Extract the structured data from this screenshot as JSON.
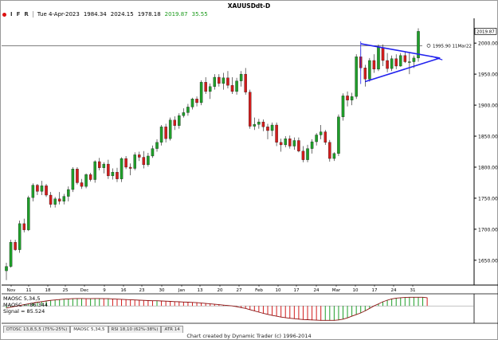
{
  "window": {
    "title": "XAUUSDdt-D",
    "toolbar": [
      "I",
      "F",
      "R"
    ]
  },
  "info": {
    "date": "Tue 4-Apr-2023",
    "open": "1984.34",
    "high": "2024.15",
    "low": "1978.18",
    "close": "2019.87",
    "change": "35.55"
  },
  "price_panel": {
    "last_price_label": "2019.87",
    "annotation": "1995.90 11Mar22",
    "colors": {
      "up": "#1f9e2a",
      "down": "#d21c1c",
      "triangle": "#2222ee",
      "background": "#ffffff"
    }
  },
  "chart_data": [
    {
      "type": "candlestick",
      "title": "XAUUSDdt-D",
      "ylim": [
        1610,
        2040
      ],
      "yticks": [
        1650,
        1700,
        1750,
        1800,
        1850,
        1900,
        1950,
        2000
      ],
      "xlabels": [
        "Nov",
        "11",
        "18",
        "25",
        "Dec",
        "9",
        "16",
        "23",
        "30",
        "Jan",
        "13",
        "20",
        "27",
        "Feb",
        "10",
        "17",
        "24",
        "Mar",
        "10",
        "17",
        "24",
        "31"
      ],
      "grid": false,
      "candles": [
        [
          1633,
          1646,
          1618,
          1640
        ],
        [
          1640,
          1683,
          1638,
          1679
        ],
        [
          1679,
          1683,
          1665,
          1667
        ],
        [
          1667,
          1714,
          1662,
          1709
        ],
        [
          1709,
          1717,
          1695,
          1699
        ],
        [
          1699,
          1754,
          1697,
          1751
        ],
        [
          1751,
          1774,
          1745,
          1771
        ],
        [
          1771,
          1773,
          1755,
          1761
        ],
        [
          1761,
          1778,
          1755,
          1770
        ],
        [
          1770,
          1773,
          1752,
          1755
        ],
        [
          1755,
          1760,
          1735,
          1740
        ],
        [
          1740,
          1752,
          1735,
          1749
        ],
        [
          1749,
          1760,
          1740,
          1745
        ],
        [
          1745,
          1757,
          1740,
          1753
        ],
        [
          1753,
          1769,
          1745,
          1764
        ],
        [
          1764,
          1800,
          1760,
          1797
        ],
        [
          1797,
          1800,
          1772,
          1775
        ],
        [
          1775,
          1781,
          1765,
          1769
        ],
        [
          1769,
          1790,
          1766,
          1788
        ],
        [
          1788,
          1791,
          1777,
          1780
        ],
        [
          1780,
          1811,
          1775,
          1809
        ],
        [
          1809,
          1815,
          1795,
          1799
        ],
        [
          1799,
          1808,
          1790,
          1805
        ],
        [
          1805,
          1812,
          1781,
          1786
        ],
        [
          1786,
          1798,
          1780,
          1792
        ],
        [
          1792,
          1799,
          1776,
          1781
        ],
        [
          1781,
          1816,
          1776,
          1814
        ],
        [
          1814,
          1818,
          1797,
          1800
        ],
        [
          1800,
          1806,
          1787,
          1798
        ],
        [
          1798,
          1824,
          1795,
          1820
        ],
        [
          1820,
          1825,
          1810,
          1816
        ],
        [
          1816,
          1826,
          1798,
          1804
        ],
        [
          1804,
          1823,
          1801,
          1818
        ],
        [
          1818,
          1835,
          1815,
          1830
        ],
        [
          1830,
          1845,
          1825,
          1840
        ],
        [
          1840,
          1868,
          1835,
          1865
        ],
        [
          1865,
          1870,
          1840,
          1846
        ],
        [
          1846,
          1880,
          1843,
          1876
        ],
        [
          1876,
          1882,
          1860,
          1867
        ],
        [
          1867,
          1887,
          1862,
          1883
        ],
        [
          1883,
          1895,
          1880,
          1888
        ],
        [
          1888,
          1902,
          1883,
          1897
        ],
        [
          1897,
          1912,
          1893,
          1910
        ],
        [
          1910,
          1914,
          1898,
          1904
        ],
        [
          1904,
          1940,
          1900,
          1937
        ],
        [
          1937,
          1945,
          1918,
          1922
        ],
        [
          1922,
          1935,
          1910,
          1930
        ],
        [
          1930,
          1950,
          1925,
          1945
        ],
        [
          1945,
          1950,
          1930,
          1935
        ],
        [
          1935,
          1952,
          1925,
          1944
        ],
        [
          1944,
          1955,
          1927,
          1932
        ],
        [
          1932,
          1945,
          1918,
          1922
        ],
        [
          1922,
          1944,
          1917,
          1939
        ],
        [
          1939,
          1955,
          1930,
          1950
        ],
        [
          1950,
          1960,
          1917,
          1921
        ],
        [
          1921,
          1925,
          1862,
          1866
        ],
        [
          1866,
          1880,
          1860,
          1869
        ],
        [
          1869,
          1878,
          1862,
          1873
        ],
        [
          1873,
          1877,
          1858,
          1865
        ],
        [
          1865,
          1870,
          1845,
          1859
        ],
        [
          1859,
          1872,
          1850,
          1868
        ],
        [
          1868,
          1872,
          1834,
          1840
        ],
        [
          1840,
          1846,
          1825,
          1836
        ],
        [
          1836,
          1850,
          1832,
          1846
        ],
        [
          1846,
          1851,
          1830,
          1834
        ],
        [
          1834,
          1848,
          1828,
          1843
        ],
        [
          1843,
          1848,
          1824,
          1826
        ],
        [
          1826,
          1834,
          1808,
          1812
        ],
        [
          1812,
          1836,
          1808,
          1830
        ],
        [
          1830,
          1845,
          1822,
          1841
        ],
        [
          1841,
          1855,
          1835,
          1852
        ],
        [
          1852,
          1868,
          1845,
          1857
        ],
        [
          1857,
          1860,
          1836,
          1840
        ],
        [
          1840,
          1844,
          1809,
          1814
        ],
        [
          1814,
          1824,
          1810,
          1822
        ],
        [
          1822,
          1885,
          1818,
          1881
        ],
        [
          1881,
          1919,
          1875,
          1915
        ],
        [
          1915,
          1922,
          1898,
          1908
        ],
        [
          1908,
          1920,
          1900,
          1914
        ],
        [
          1914,
          1982,
          1910,
          1978
        ],
        [
          1978,
          1990,
          1955,
          1960
        ],
        [
          1960,
          1965,
          1930,
          1942
        ],
        [
          1942,
          1976,
          1938,
          1972
        ],
        [
          1972,
          1982,
          1952,
          1958
        ],
        [
          1958,
          1998,
          1955,
          1993
        ],
        [
          1993,
          1998,
          1963,
          1972
        ],
        [
          1972,
          1984,
          1953,
          1959
        ],
        [
          1959,
          1980,
          1955,
          1975
        ],
        [
          1975,
          1982,
          1958,
          1963
        ],
        [
          1963,
          1984,
          1962,
          1980
        ],
        [
          1980,
          1986,
          1968,
          1970
        ],
        [
          1970,
          1985,
          1950,
          1970
        ],
        [
          1970,
          1980,
          1960,
          1976
        ],
        [
          1976,
          2024,
          1970,
          2019
        ]
      ],
      "triangle": {
        "upper": [
          [
            1999,
            80
          ],
          [
            1976,
            97
          ]
        ],
        "lower": [
          [
            1938,
            81
          ],
          [
            1976,
            97
          ]
        ]
      }
    },
    {
      "type": "line",
      "title": "",
      "series": [
        {
          "name": "MAOSC",
          "label": "MAOSC 5,34,5"
        },
        {
          "name": "MAOSC = 86.344"
        },
        {
          "name": "Signal = 85.524"
        }
      ],
      "values": [
        -10,
        -6,
        -2,
        2,
        6,
        10,
        14,
        18,
        21,
        24,
        27,
        29,
        31,
        33,
        34,
        35,
        36,
        36,
        35,
        35,
        36,
        36,
        35,
        35,
        34,
        33,
        32,
        31,
        30,
        29,
        28,
        27,
        26,
        25,
        25,
        24,
        23,
        22,
        21,
        20,
        19,
        18,
        17,
        16,
        14,
        12,
        10,
        8,
        6,
        4,
        2,
        0,
        -4,
        -8,
        -12,
        -18,
        -24,
        -30,
        -36,
        -41,
        -46,
        -50,
        -54,
        -57,
        -60,
        -62,
        -64,
        -66,
        -67,
        -68,
        -69,
        -70,
        -70,
        -70,
        -70,
        -68,
        -64,
        -58,
        -50,
        -42,
        -34,
        -24,
        -12,
        0,
        10,
        20,
        28,
        34,
        38,
        40,
        41,
        42,
        42,
        42,
        42,
        40
      ]
    }
  ],
  "osc_panel": {
    "title_label": "MAOSC 5,34,5",
    "maosc_label": "MAOSC = 86.344",
    "signal_label": "Signal = 85.524"
  },
  "tabs": [
    {
      "label": "DTOSC 13,8,5,5 (75%-25%)"
    },
    {
      "label": "MAOSC 5,34,5"
    },
    {
      "label": "RSI 18,10 (62%-38%)"
    },
    {
      "label": "ATR 14"
    }
  ],
  "footer": {
    "credit": "Chart created by Dynamic Trader  (c) 1996-2014"
  }
}
